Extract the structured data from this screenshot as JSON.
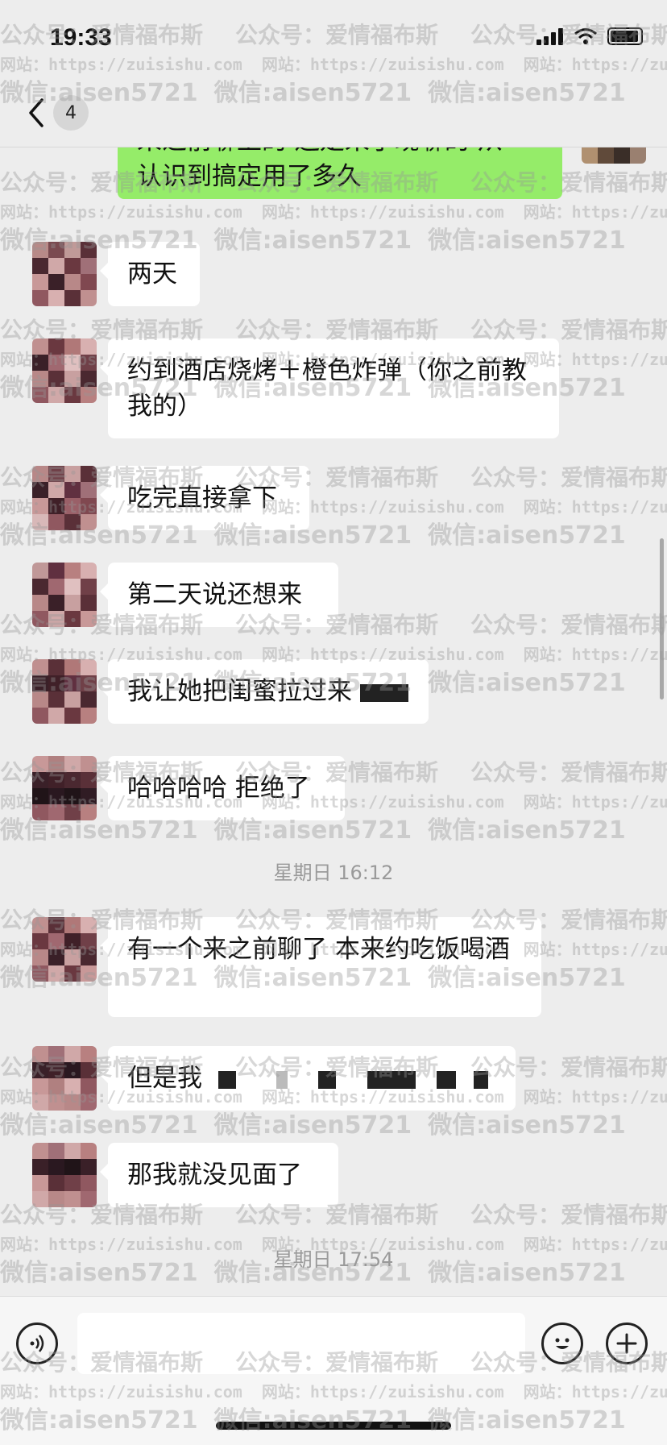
{
  "status": {
    "time": "19:33"
  },
  "nav": {
    "unread_count": "4"
  },
  "messages": {
    "partial_me": "认识到搞定用了多久",
    "partial_me_top": "来之前聊上的 还是来了现聊的 从",
    "m1": "两天",
    "m2": "约到酒店烧烤＋橙色炸弹（你之前教我的）",
    "m3": "吃完直接拿下",
    "m4": "第二天说还想来",
    "m5": "我让她把闺蜜拉过来",
    "m6": "哈哈哈哈 拒绝了",
    "time1": "星期日 16:12",
    "m7": "有一个来之前聊了 本来约吃饭喝酒",
    "m8": "但是我",
    "m9": "那我就没见面了",
    "time2": "星期日 17:54"
  },
  "watermark": {
    "line1": "公众号：爱情福布斯",
    "line2": "网站：https://zuisishu.com",
    "line3": "微信:aisen5721"
  },
  "colors": {
    "background": "#ededed",
    "my_bubble": "#95ec69",
    "other_bubble": "#ffffff"
  },
  "icons": [
    "chevron-left-icon",
    "voice-icon",
    "emoji-icon",
    "plus-icon",
    "signal-icon",
    "wifi-icon",
    "battery-icon"
  ]
}
